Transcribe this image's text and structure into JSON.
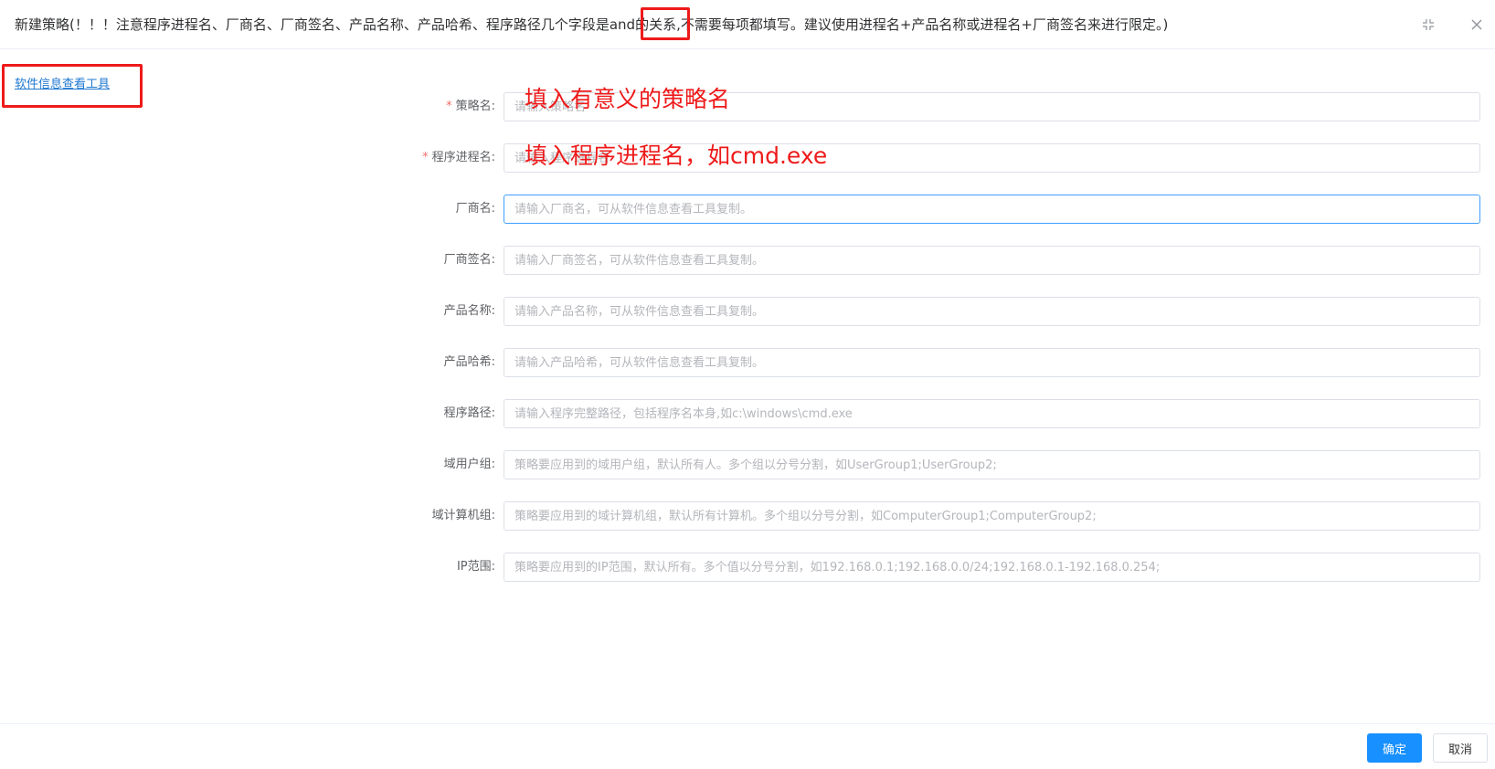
{
  "dialog": {
    "title": "新建策略(！！！注意程序进程名、厂商名、厂商签名、产品名称、产品哈希、程序路径几个字段是and的关系,不需要每项都填写。建议使用进程名+产品名称或进程名+厂商签名来进行限定。)",
    "fullscreen_icon": "fullscreen-shrink-icon",
    "close_icon": "close-icon"
  },
  "tool_link": "软件信息查看工具",
  "form": {
    "fields": [
      {
        "label": "策略名:",
        "required": true,
        "placeholder": "请输入策略名",
        "value": ""
      },
      {
        "label": "程序进程名:",
        "required": true,
        "placeholder": "请输入程序进程名",
        "value": ""
      },
      {
        "label": "厂商名:",
        "required": false,
        "placeholder": "请输入厂商名，可从软件信息查看工具复制。",
        "value": ""
      },
      {
        "label": "厂商签名:",
        "required": false,
        "placeholder": "请输入厂商签名，可从软件信息查看工具复制。",
        "value": ""
      },
      {
        "label": "产品名称:",
        "required": false,
        "placeholder": "请输入产品名称，可从软件信息查看工具复制。",
        "value": ""
      },
      {
        "label": "产品哈希:",
        "required": false,
        "placeholder": "请输入产品哈希，可从软件信息查看工具复制。",
        "value": ""
      },
      {
        "label": "程序路径:",
        "required": false,
        "placeholder": "请输入程序完整路径，包括程序名本身,如c:\\windows\\cmd.exe",
        "value": ""
      },
      {
        "label": "域用户组:",
        "required": false,
        "placeholder": "策略要应用到的域用户组，默认所有人。多个组以分号分割，如UserGroup1;UserGroup2;",
        "value": ""
      },
      {
        "label": "域计算机组:",
        "required": false,
        "placeholder": "策略要应用到的域计算机组，默认所有计算机。多个组以分号分割，如ComputerGroup1;ComputerGroup2;",
        "value": ""
      },
      {
        "label": "IP范围:",
        "required": false,
        "placeholder": "策略要应用到的IP范围，默认所有。多个值以分号分割，如192.168.0.1;192.168.0.0/24;192.168.0.1-192.168.0.254;",
        "value": ""
      }
    ]
  },
  "annotations": {
    "policy_name": "填入有意义的策略名",
    "process_name": "填入程序进程名，如cmd.exe"
  },
  "buttons": {
    "ok": "确定",
    "cancel": "取消"
  },
  "colors": {
    "primary": "#1890ff",
    "annotation_red": "#ee1a1a",
    "link": "#1f78d1",
    "required": "#f56c6c"
  }
}
